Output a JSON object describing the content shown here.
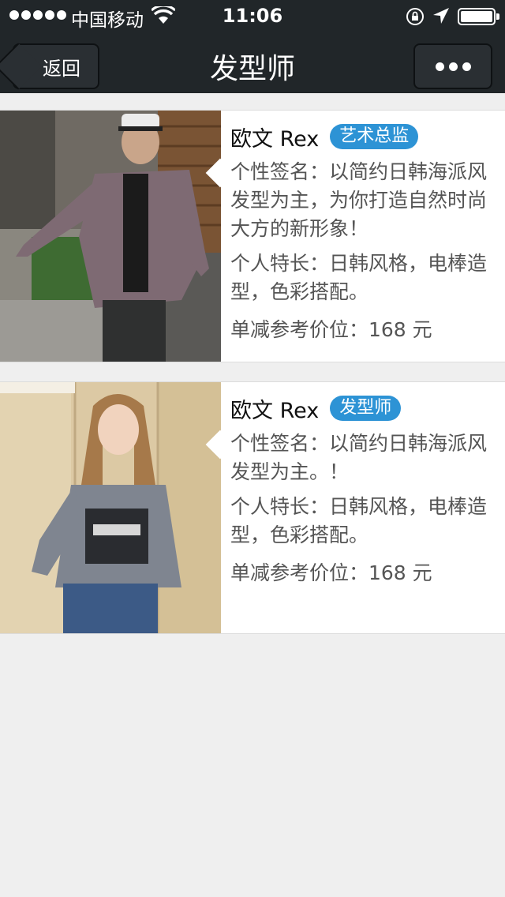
{
  "status_bar": {
    "carrier": "中国移动",
    "time": "11:06"
  },
  "nav": {
    "back_label": "返回",
    "title": "发型师"
  },
  "stylists": [
    {
      "name": "欧文 Rex",
      "role": "艺术总监",
      "signature": "个性签名：以简约日韩海派风发型为主，为你打造自然时尚大方的新形象！",
      "specialty": "个人特长：日韩风格，电棒造型，色彩搭配。",
      "price": "单减参考价位：168 元"
    },
    {
      "name": "欧文 Rex",
      "role": "发型师",
      "signature": "个性签名：以简约日韩海派风发型为主。！",
      "specialty": "个人特长：日韩风格，电棒造型，色彩搭配。",
      "price": "单减参考价位：168 元"
    }
  ],
  "colors": {
    "nav_bg": "#212629",
    "badge": "#2d93d5",
    "page_bg": "#efefef"
  }
}
